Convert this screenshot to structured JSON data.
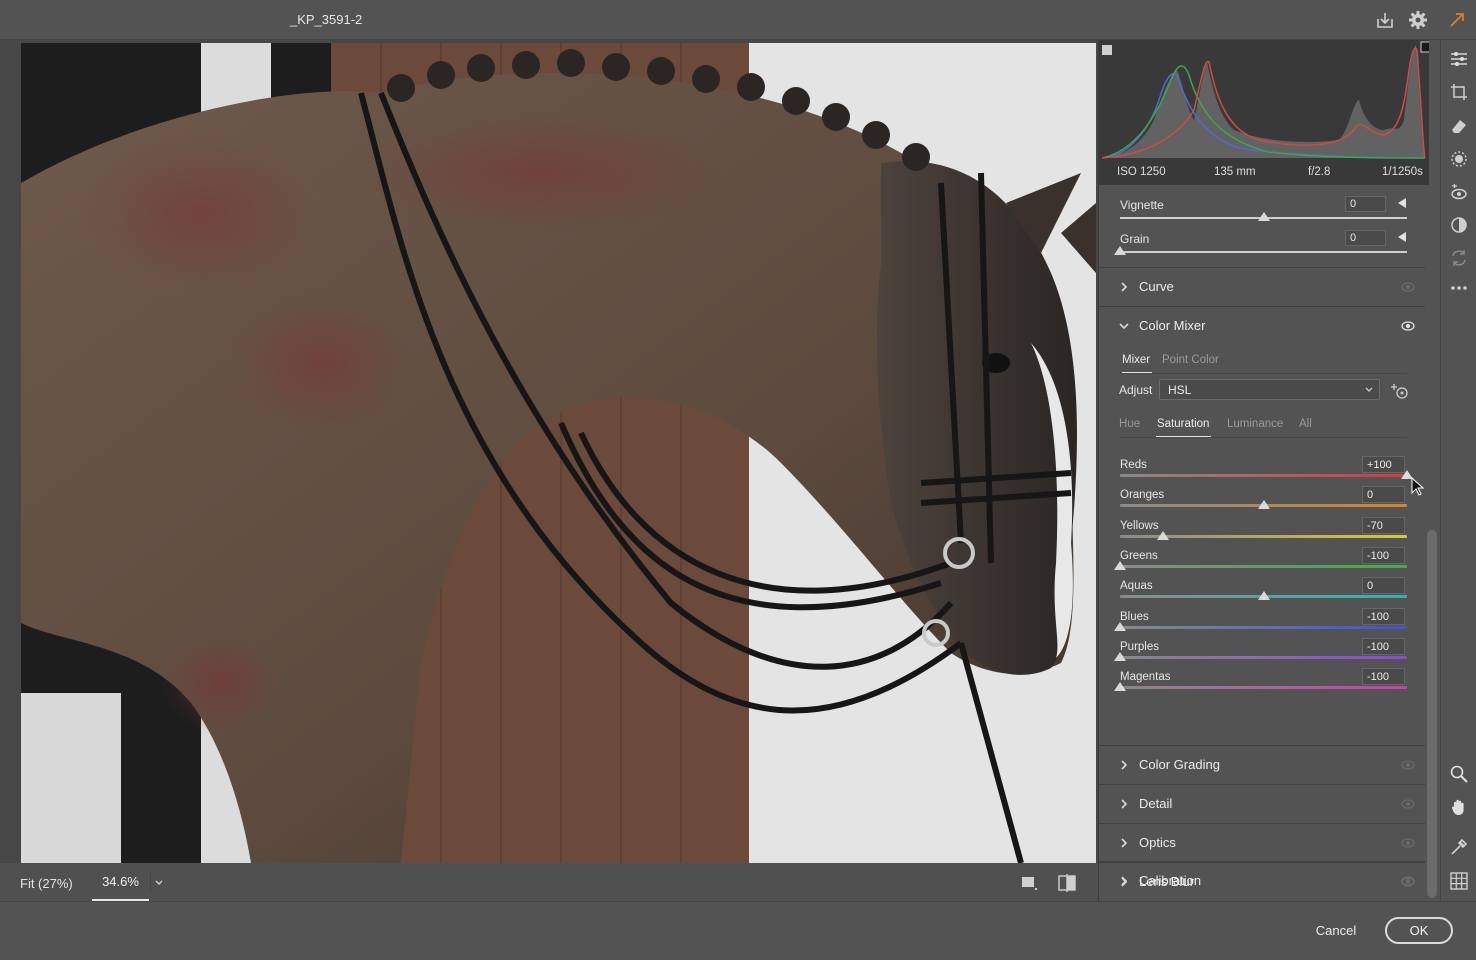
{
  "window": {
    "title": "_KP_3591-2"
  },
  "toolbar": {
    "icons": [
      "save-icon",
      "settings-icon",
      "expand-icon"
    ]
  },
  "canvas": {
    "zoom_fit_label": "Fit (27%)",
    "zoom_value": "34.6%",
    "photo_description_icon": "horse-photo"
  },
  "histogram": {
    "exif": {
      "iso": "ISO 1250",
      "focal": "135 mm",
      "aperture": "f/2.8",
      "shutter": "1/1250s"
    }
  },
  "effects": {
    "vignette": {
      "label": "Vignette",
      "value": "0",
      "fraction": 0.5
    },
    "grain": {
      "label": "Grain",
      "value": "0",
      "fraction": 0.0
    }
  },
  "sections": {
    "curve": "Curve",
    "color_mixer": "Color Mixer",
    "color_grading": "Color Grading",
    "detail": "Detail",
    "optics": "Optics",
    "lens_blur": "Lens Blur",
    "calibration": "Calibration"
  },
  "mixer": {
    "tabs": [
      "Mixer",
      "Point Color"
    ],
    "active_tab": "Mixer",
    "adjust_label": "Adjust",
    "adjust_value": "HSL",
    "subtabs": [
      "Hue",
      "Saturation",
      "Luminance",
      "All"
    ],
    "active_subtab": "Saturation",
    "channels": [
      {
        "label": "Reds",
        "value": "+100",
        "fraction": 1.0,
        "color": "#d23c3c"
      },
      {
        "label": "Oranges",
        "value": "0",
        "fraction": 0.5,
        "color": "#d9822b"
      },
      {
        "label": "Yellows",
        "value": "-70",
        "fraction": 0.15,
        "color": "#d6c93a"
      },
      {
        "label": "Greens",
        "value": "-100",
        "fraction": 0.0,
        "color": "#3fae49"
      },
      {
        "label": "Aquas",
        "value": "0",
        "fraction": 0.5,
        "color": "#2fb4b4"
      },
      {
        "label": "Blues",
        "value": "-100",
        "fraction": 0.0,
        "color": "#3a55d6"
      },
      {
        "label": "Purples",
        "value": "-100",
        "fraction": 0.0,
        "color": "#8a4ad4"
      },
      {
        "label": "Magentas",
        "value": "-100",
        "fraction": 0.0,
        "color": "#c93eb4"
      }
    ]
  },
  "tools": [
    "edit-icon",
    "crop-icon",
    "eraser-icon",
    "masking-icon",
    "redeye-icon",
    "presets-icon",
    "snapshots-icon",
    "more-icon",
    "zoom-icon",
    "hand-icon",
    "sampler-icon",
    "grid-icon"
  ],
  "footer": {
    "cancel_label": "Cancel",
    "ok_label": "OK"
  },
  "colors": {
    "panel_bg": "#535353",
    "accent_ok_border": "#dcdcdc"
  }
}
